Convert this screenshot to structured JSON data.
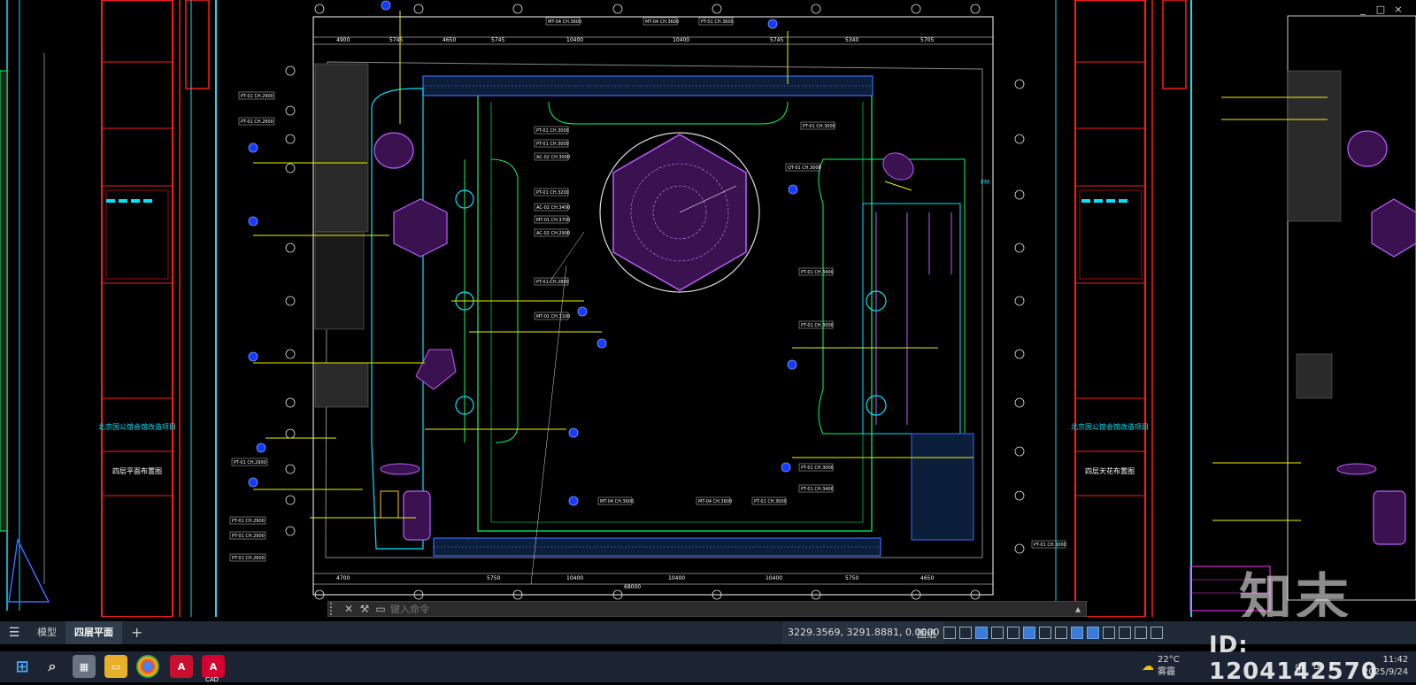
{
  "window_controls": [
    "_",
    "□",
    "×"
  ],
  "drawing": {
    "left_title": "北京国公馆会馆改造项目",
    "left_subtitle": "四层平面布置图",
    "right_title": "北京国公馆会馆改造项目",
    "right_subtitle": "四层天花布置图",
    "dims_top": [
      "4900",
      "5745",
      "4650",
      "5745",
      "10400",
      "10400",
      "5745",
      "5340",
      "5705"
    ],
    "dims_bottom": [
      "4700",
      "5750",
      "10400",
      "10400",
      "10400",
      "5750",
      "4650"
    ],
    "dim_total_bottom": "68000",
    "labels_left": [
      "PT-01 CH.2900",
      "PT-01 CH.2900",
      "PT-01 CH.2900",
      "PT-01 CH.2900",
      "PT-01 CH.2900",
      "PT-01 CH.2600"
    ],
    "labels_mid": [
      "PT-01 CH.3000",
      "PT-01 CH.3000",
      "AC-02 CH.3000",
      "PT-01 CH.3200",
      "AC-02 CH.3400",
      "MT-01 CH.3700",
      "AC-02 CH.2900",
      "PT-01 CH.2800",
      "MT-01 CH.3100"
    ],
    "labels_right": [
      "PT-01 CH.3000",
      "QT-01 CH.3000",
      "PT-01 CH.3400",
      "PT-01 CH.3000",
      "PT-01 CH.3000",
      "PT-01 CH.3400",
      "PT-01 CH.3000"
    ],
    "labels_top": [
      "MT-04 CH.3600",
      "MT-04 CH.3600",
      "PT-01 CH.3600"
    ],
    "labels_bottom": [
      "MT-04 CH.3600",
      "MT-04 CH.3600",
      "PT-01 CH.3000"
    ],
    "legend_fm": "FM"
  },
  "command_line": {
    "placeholder": "键入命令"
  },
  "status_bar": {
    "tabs": [
      "模型",
      "四层平面",
      "+"
    ],
    "active_tab": "四层平面",
    "coordinates": "3229.3569, 3291.8881, 0.0000",
    "paper_label": "图纸"
  },
  "taskbar": {
    "apps": [
      "start",
      "search",
      "calculator",
      "file-explorer",
      "chrome",
      "acrobat",
      "autocad"
    ],
    "cad_label": "CAD",
    "weather_temp": "22°C",
    "weather_desc": "雾霾",
    "time": "11:42",
    "date": "2025/9/24",
    "ime": "中",
    "ime_caret": "^"
  },
  "watermark": {
    "id_text": "ID: 1204142570",
    "logo_text": "知末"
  },
  "colors": {
    "canvas_bg": "#000000",
    "title_block_red": "#ff1a1a",
    "cyan": "#00e5ff",
    "yellow": "#f2f200",
    "green": "#00ff66",
    "magenta": "#c05cff",
    "status_bg": "#1f2a36",
    "taskbar_bg": "#1c2433"
  }
}
